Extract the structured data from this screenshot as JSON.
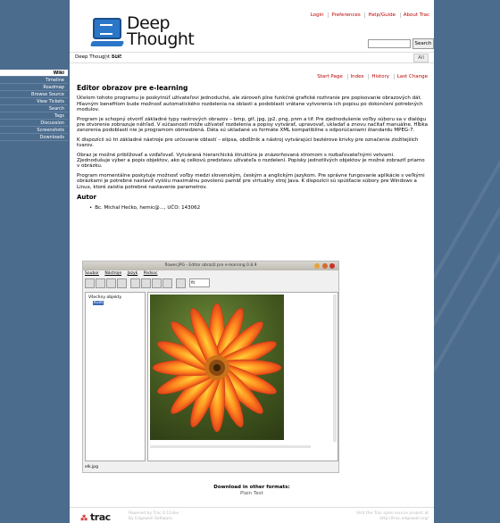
{
  "header": {
    "logo_line1": "Deep",
    "logo_line2": "Thought",
    "metanav": [
      "Login",
      "Preferences",
      "Help/Guide",
      "About Trac"
    ],
    "search_button": "Search"
  },
  "breadcrumbs": {
    "root": "Deep Thought >>",
    "current": "ELIE",
    "all_label": "All"
  },
  "ctxnav": [
    "Start Page",
    "Index",
    "History",
    "Last Change"
  ],
  "sidebar": {
    "items": [
      "Wiki",
      "Timeline",
      "Roadmap",
      "Browse Source",
      "View Tickets",
      "Search",
      "Tags",
      "Discussion",
      "Screenshots",
      "Downloads"
    ],
    "active_index": 0
  },
  "content": {
    "title": "Editor obrazov pre e-learning",
    "paragraphs": [
      "Účelom tohoto programu je poskytnúť užívateľovi jednoduché, ale zároveň plne funkčné grafické rozhranie pre popisovanie obrazových dát. Hlavným benefitom bude možnosť automatického rozdelenia na oblasti a podoblasti vrátane vytvorenia ich popisu po dokončení potrebných modulov.",
      "Program je schopný otvoriť základné typy rastrových obrazov – bmp, gif, jpg, jp2, png, pnm a tif. Pre zjednodušenie voľby súboru sa v dialógu pre otvorenie zobrazuje náhľad. V súčasnosti môže užívateľ rozdelenia a popisy vytvárať, upravovať, ukladať a znovu načítať manuálne. Hĺbka zanorenia podoblastí nie je programom obmedzená. Dáta sú ukladané vo formáte XML kompatibilne s odporúčaniami štandardu MPEG-7.",
      "K dispozícii sú tri základné nástroje pre určovanie oblastí – elipsa, obdĺžnik a nástroj vytvárajúci beziérove krivky pre označenie zložitejších tvarov.",
      "Obraz je možné priblížovať a vzďaľovať. Vytváraná hierarchická štruktúra je znázorňovaná stromom s rozbaľovateľnými vetvami. Zjednodušuje výber a popis objektov, ako aj celkovú predstavu užívateľa o rozdelení. Popisky jednotlivých objektov je možné zobraziť priamo v obrázku.",
      "Program momentálne poskytuje možnosť voľby medzi slovenským, českým a anglickým jazykom. Pre správne fungovanie aplikácie s veľkými obrázkami je potrebné nastaviť vyššiu maximálnu povolenú pamäť pre virtuálny stroj Java. K dispozícii sú spúšťacie súbory pre Windows a Linux, ktoré zaistia potrebné nastavenie parametrov."
    ],
    "author_heading": "Autor",
    "author": "Bc. Michal Hečko, hemic@..., UČO: 143062"
  },
  "app_screenshot": {
    "title": "flower.JPG - Editor obrazů pre e-learning 0.8.9",
    "menu": [
      "Soubor",
      "Nástroje",
      "Jazyk",
      "Podsoc"
    ],
    "zoom": "fit",
    "tree_root": "Všechny objekty",
    "tree_child": "Kvet",
    "status": "elk.jpg"
  },
  "download": {
    "heading": "Download in other formats:",
    "link": "Plain Text"
  },
  "footer": {
    "logo": "trac",
    "powered_line1": "Powered by Trac 0.11dev",
    "powered_line2": "By Edgewall Software.",
    "visit_line1": "Visit the Trac open source project at",
    "visit_line2": "http://trac.edgewall.org/"
  },
  "colors": {
    "background": "#4c6c8e",
    "link_red": "#bb0000",
    "accent_blue": "#2a76c8"
  }
}
